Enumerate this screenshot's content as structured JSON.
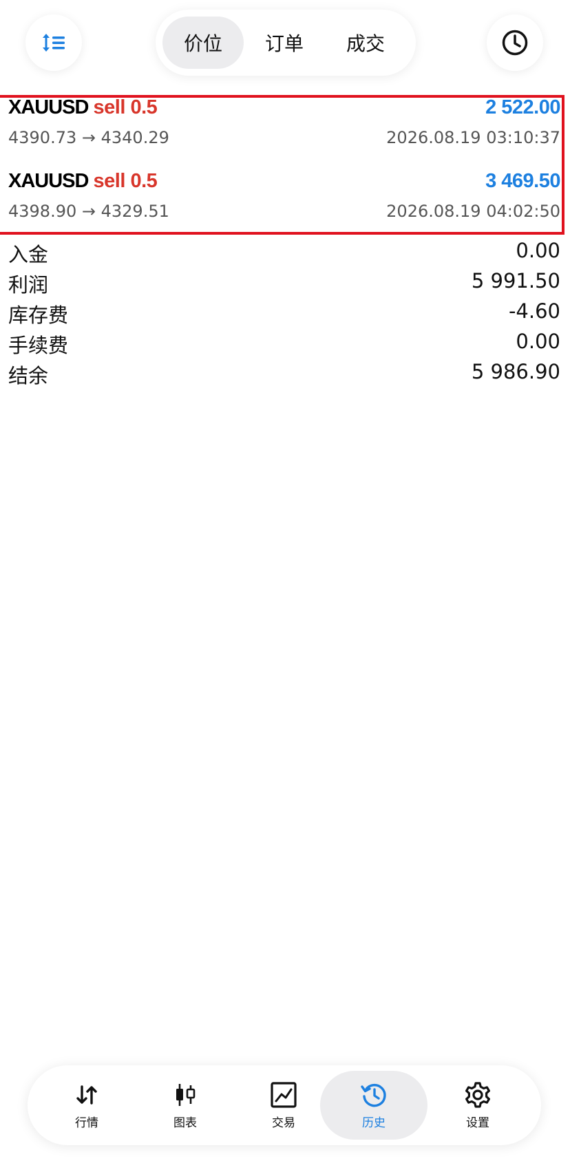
{
  "header": {
    "sort_icon": "sort-list-icon",
    "history_icon": "clock-icon",
    "tabs": [
      {
        "label": "价位",
        "active": true
      },
      {
        "label": "订单",
        "active": false
      },
      {
        "label": "成交",
        "active": false
      }
    ]
  },
  "deals": [
    {
      "symbol": "XAUUSD",
      "type": "sell 0.5",
      "profit": "2 522.00",
      "prices": "4390.73 → 4340.29",
      "time": "2026.08.19 03:10:37"
    },
    {
      "symbol": "XAUUSD",
      "type": "sell 0.5",
      "profit": "3 469.50",
      "prices": "4398.90 → 4329.51",
      "time": "2026.08.19 04:02:50"
    }
  ],
  "summary": [
    {
      "label": "入金",
      "value": "0.00"
    },
    {
      "label": "利润",
      "value": "5 991.50"
    },
    {
      "label": "库存费",
      "value": "-4.60"
    },
    {
      "label": "手续费",
      "value": "0.00"
    },
    {
      "label": "结余",
      "value": "5 986.90"
    }
  ],
  "nav": [
    {
      "label": "行情",
      "icon": "quotes-arrows-icon",
      "active": false
    },
    {
      "label": "图表",
      "icon": "candlestick-chart-icon",
      "active": false
    },
    {
      "label": "交易",
      "icon": "trade-chart-icon",
      "active": false
    },
    {
      "label": "历史",
      "icon": "history-icon",
      "active": true
    },
    {
      "label": "设置",
      "icon": "gear-icon",
      "active": false
    }
  ],
  "colors": {
    "accent": "#1d80e0",
    "sell": "#d8362b",
    "highlight_frame": "#e0121e"
  }
}
